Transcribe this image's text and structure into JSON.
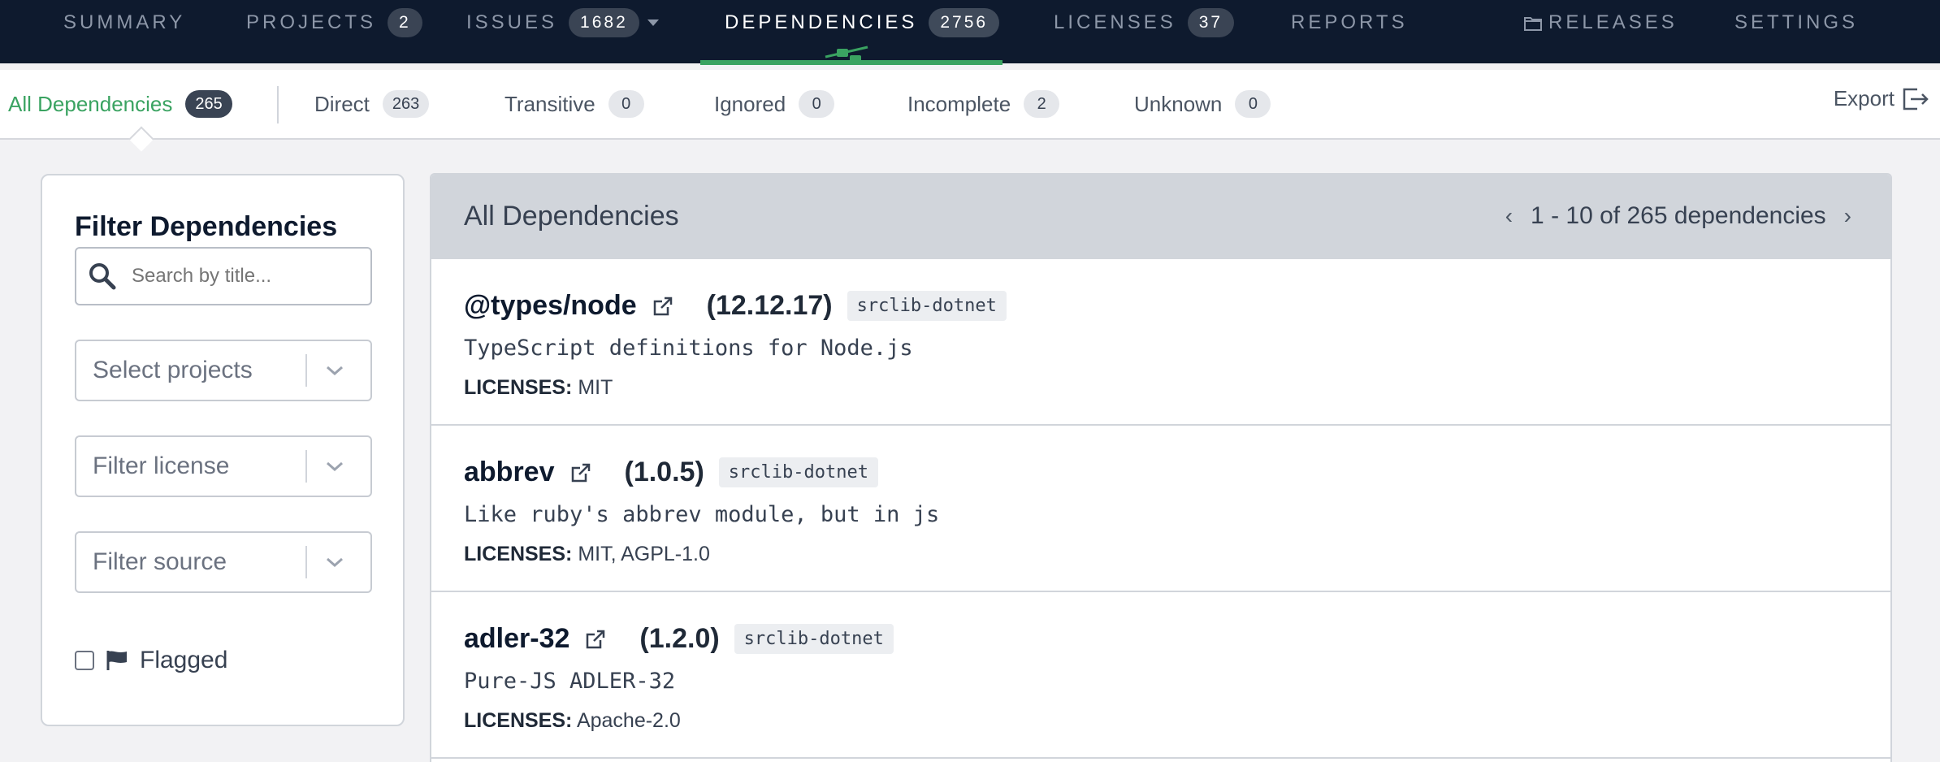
{
  "top_nav": {
    "summary": "SUMMARY",
    "projects": {
      "label": "PROJECTS",
      "count": "2"
    },
    "issues": {
      "label": "ISSUES",
      "count": "1682"
    },
    "dependencies": {
      "label": "DEPENDENCIES",
      "count": "2756"
    },
    "licenses": {
      "label": "LICENSES",
      "count": "37"
    },
    "reports": "REPORTS",
    "releases": "RELEASES",
    "settings": "SETTINGS"
  },
  "sub_nav": {
    "all": {
      "label": "All Dependencies",
      "count": "265"
    },
    "direct": {
      "label": "Direct",
      "count": "263"
    },
    "transitive": {
      "label": "Transitive",
      "count": "0"
    },
    "ignored": {
      "label": "Ignored",
      "count": "0"
    },
    "incomplete": {
      "label": "Incomplete",
      "count": "2"
    },
    "unknown": {
      "label": "Unknown",
      "count": "0"
    },
    "export": "Export"
  },
  "filter": {
    "title": "Filter Dependencies",
    "search_placeholder": "Search by title...",
    "projects_placeholder": "Select projects",
    "license_placeholder": "Filter license",
    "source_placeholder": "Filter source",
    "flagged_label": "Flagged"
  },
  "list": {
    "title": "All Dependencies",
    "pagination": "1 - 10 of 265 dependencies",
    "licenses_label": "LICENSES:",
    "items": [
      {
        "name": "@types/node",
        "version": "(12.12.17)",
        "source": "srclib-dotnet",
        "description": "TypeScript definitions for Node.js",
        "licenses": "MIT"
      },
      {
        "name": "abbrev",
        "version": "(1.0.5)",
        "source": "srclib-dotnet",
        "description": "Like ruby's abbrev module, but in js",
        "licenses": "MIT, AGPL-1.0"
      },
      {
        "name": "adler-32",
        "version": "(1.2.0)",
        "source": "srclib-dotnet",
        "description": "Pure-JS ADLER-32",
        "licenses": "Apache-2.0"
      }
    ]
  },
  "colors": {
    "nav_bg": "#0e1a2e",
    "accent": "#3aa361",
    "panel_header": "#d1d5db"
  }
}
